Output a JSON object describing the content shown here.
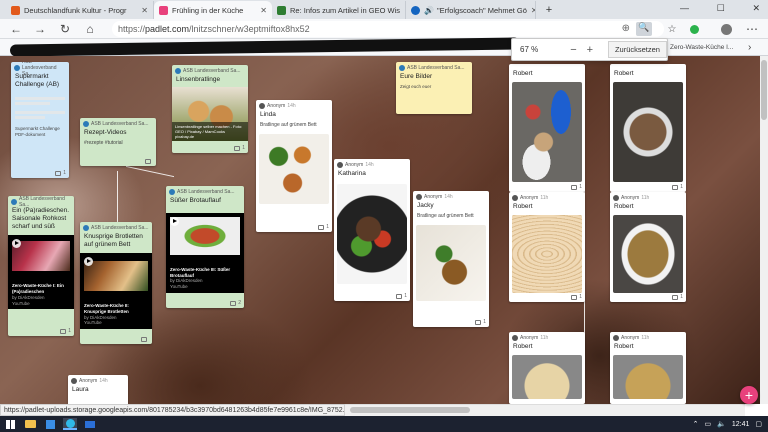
{
  "tabs": [
    {
      "label": "Deutschlandfunk Kultur - Progr",
      "color": "#e25a1c"
    },
    {
      "label": "Frühling in der Küche",
      "color": "#e8417c"
    },
    {
      "label": "Re: Infos zum Artikel in GEO Wis",
      "color": "#2e7d32"
    },
    {
      "label": "\"Erfolgscoach\" Mehmet Gö",
      "color": "#c62828"
    }
  ],
  "new_tab": "+",
  "address": {
    "prefix": "https://",
    "host": "padlet.com",
    "path": "/lnitzschner/w3eptmiftox8hx52"
  },
  "bookmarks_right": "Zero-Waste-Küche I...",
  "zoom": {
    "percent": "67 %",
    "minus": "−",
    "plus": "+",
    "reset": "Zurücksetzen"
  },
  "posts": [
    {
      "author": "ASB Landesverband Sa...",
      "title": "Supermarkt Challenge (AB)",
      "body": "Supermarkt Challenge PDF-dokument",
      "count": "1"
    },
    {
      "author": "ASB Landesverband Sa...",
      "title": "Rezept-Videos",
      "body": "#rezepte #tutorial",
      "count": ""
    },
    {
      "author": "ASB Landesverband Sa...",
      "title": "Linsenbratlinge",
      "body": "Linsenbratlinge selber machen - Foto: GEO / Pixabay / MamCooks",
      "source": "pixabay.de",
      "count": "1"
    },
    {
      "author": "Anonym",
      "time": "14h",
      "title": "Linda",
      "body": "Bratlinge auf grünem Bett",
      "count": "1"
    },
    {
      "author": "ASB Landesverband Sa...",
      "title": "Eure Bilder",
      "body": "Zeigt euch euer",
      "count": ""
    },
    {
      "author": "ASB Landesverband Sa...",
      "title": "Ein (Pa)radieschen. Saisonale Rohkost scharf und süß",
      "video": "Zero-Waste-Küche I: Ein (Pa)radieschen",
      "video_by": "by DiAkDresden",
      "source": "YouTube",
      "count": "1"
    },
    {
      "author": "ASB Landesverband Sa...",
      "title": "Knusprige Brotletten auf grünem Bett",
      "video": "Zero-Waste-Küche II: Knusprige Brotletten",
      "video_by": "by DiAkDresden",
      "source": "YouTube",
      "count": ""
    },
    {
      "author": "ASB Landesverband Sa...",
      "title": "Süßer Brotauflauf",
      "video": "Zero-Waste-Küche III: Süßer Brotauflauf",
      "video_by": "by DiAkDresden",
      "source": "YouTube",
      "count": "2"
    },
    {
      "author": "Anonym",
      "time": "14h",
      "title": "Katharina",
      "body": "",
      "count": "1"
    },
    {
      "author": "Anonym",
      "time": "14h",
      "title": "Jacky",
      "body": "Bratlinge auf grünem Bett",
      "count": "1"
    },
    {
      "author": "Anonym",
      "time": "14h",
      "title": "Laura",
      "body": "",
      "count": ""
    },
    {
      "author": "Anonym",
      "title": "Robert",
      "count": "1"
    },
    {
      "author": "Anonym",
      "time": "11h",
      "title": "Robert",
      "count": "1"
    },
    {
      "author": "Anonym",
      "time": "11h",
      "title": "Robert",
      "count": "1"
    },
    {
      "author": "Anonym",
      "time": "11h",
      "title": "Robert",
      "count": "1"
    },
    {
      "author": "Anonym",
      "time": "11h",
      "title": "Robert",
      "count": "1"
    },
    {
      "author": "Anonym",
      "time": "11h",
      "title": "Robert",
      "count": ""
    }
  ],
  "status_url": "https://padlet-uploads.storage.googleapis.com/801785234/b3c3970bd6481263b4d85fe7e9961c8e/IMG_8752.jpg",
  "fab": "+",
  "clock": "12:41",
  "colors": {
    "padlet_pink": "#e8417c",
    "card_blue": "#cfe6f7",
    "card_green": "#cfe7c8",
    "card_yellow": "#fbf0b4"
  }
}
